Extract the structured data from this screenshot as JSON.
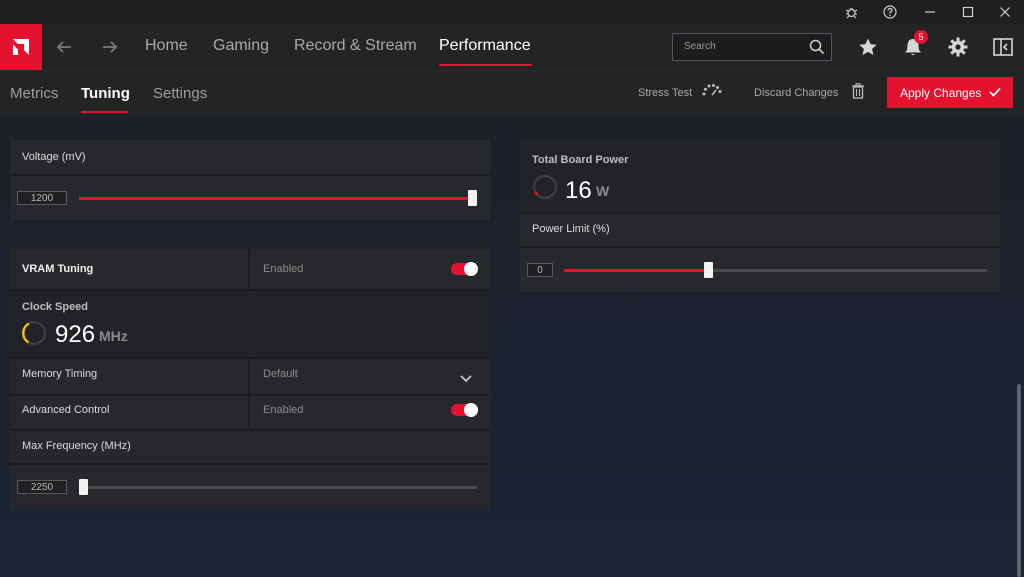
{
  "titlebar": {
    "controls": [
      "bug-icon",
      "help-icon",
      "minimize-icon",
      "maximize-icon",
      "close-icon"
    ]
  },
  "nav": {
    "logo": "amd-logo",
    "tabs": [
      {
        "label": "Home"
      },
      {
        "label": "Gaming"
      },
      {
        "label": "Record & Stream"
      },
      {
        "label": "Performance"
      }
    ],
    "active_tab": "Performance",
    "search_placeholder": "Search",
    "notification_count": "5"
  },
  "subnav": {
    "tabs": [
      {
        "label": "Metrics"
      },
      {
        "label": "Tuning"
      },
      {
        "label": "Settings"
      }
    ],
    "active_tab": "Tuning",
    "stress_test": "Stress Test",
    "discard_changes": "Discard Changes",
    "apply_changes": "Apply Changes"
  },
  "voltage": {
    "label": "Voltage (mV)",
    "value": "1200",
    "slider_fraction": 1.0
  },
  "vram": {
    "label": "VRAM Tuning",
    "state": "Enabled",
    "clock_label": "Clock Speed",
    "clock_value": "926",
    "clock_unit": "MHz",
    "memory_timing_label": "Memory Timing",
    "memory_timing_value": "Default",
    "advanced_label": "Advanced Control",
    "advanced_state": "Enabled",
    "max_freq_label": "Max Frequency (MHz)",
    "max_freq_value": "2250",
    "max_freq_fraction": 0.0
  },
  "power": {
    "board_label": "Total Board Power",
    "board_value": "16",
    "board_unit": "W",
    "limit_label": "Power Limit (%)",
    "limit_value": "0",
    "limit_fraction": 0.34
  },
  "colors": {
    "accent": "#e3122f",
    "gauge_yellow": "#f2c014"
  }
}
